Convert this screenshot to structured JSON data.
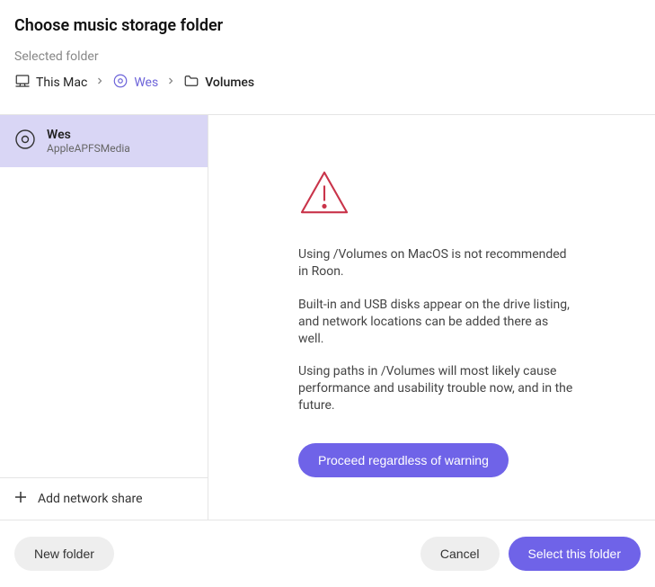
{
  "header": {
    "title": "Choose music storage folder",
    "subtitle": "Selected folder"
  },
  "breadcrumb": {
    "item0": "This Mac",
    "item1": "Wes",
    "item2": "Volumes"
  },
  "sidebar": {
    "drive": {
      "name": "Wes",
      "subtitle": "AppleAPFSMedia"
    },
    "add_share": "Add network share"
  },
  "warning": {
    "p1": "Using /Volumes on MacOS is not recommended in Roon.",
    "p2": "Built-in and USB disks appear on the drive listing, and network locations can be added there as well.",
    "p3": "Using paths in /Volumes will most likely cause performance and usability trouble now, and in the future.",
    "proceed": "Proceed regardless of warning"
  },
  "footer": {
    "new_folder": "New folder",
    "cancel": "Cancel",
    "select": "Select this folder"
  }
}
